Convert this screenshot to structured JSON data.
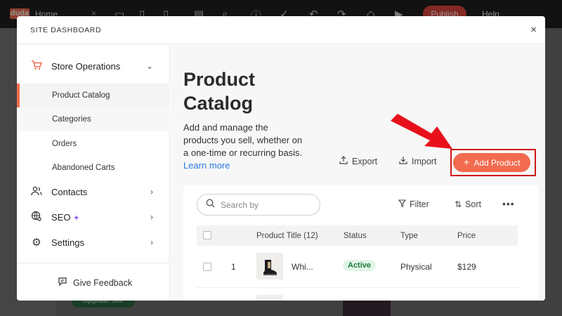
{
  "background": {
    "logo": "duda",
    "home_tab": "Home",
    "close_symbol": "×",
    "publish_label": "Publish",
    "help_label": "Help",
    "upgrade_label": "Upgrade Site"
  },
  "modal": {
    "title": "SITE DASHBOARD",
    "close_symbol": "×"
  },
  "sidebar": {
    "store_operations": {
      "label": "Store Operations",
      "icon": "cart-icon",
      "expanded": true
    },
    "sub_items": [
      {
        "label": "Product Catalog",
        "active": true
      },
      {
        "label": "Categories",
        "hover": true
      },
      {
        "label": "Orders"
      },
      {
        "label": "Abandoned Carts"
      }
    ],
    "contacts": {
      "label": "Contacts",
      "icon": "contacts-icon"
    },
    "seo": {
      "label": "SEO",
      "icon": "globe-search-icon",
      "sparkle": "✦"
    },
    "settings": {
      "label": "Settings",
      "icon": "gear-icon"
    },
    "feedback_label": "Give Feedback"
  },
  "main": {
    "title": "Product Catalog",
    "description": "Add and manage the products you sell, whether on a one-time or recurring basis.",
    "learn_more": "Learn more",
    "export_label": "Export",
    "import_label": "Import",
    "add_product_label": "Add Product",
    "search_placeholder": "Search by",
    "filter_label": "Filter",
    "sort_label": "Sort",
    "more_symbol": "•••",
    "table": {
      "headers": [
        "Product Title (12)",
        "Status",
        "Type",
        "Price"
      ],
      "rows": [
        {
          "index": "1",
          "title": "Whi...",
          "status": "Active",
          "type": "Physical",
          "price": "$129"
        }
      ]
    }
  },
  "colors": {
    "accent": "#f26b4f",
    "highlight": "#d0161a",
    "arrow": "#e8101a",
    "link": "#2a7ae2",
    "active_badge_bg": "#e1f5e6",
    "active_badge_text": "#1e7b3c"
  }
}
